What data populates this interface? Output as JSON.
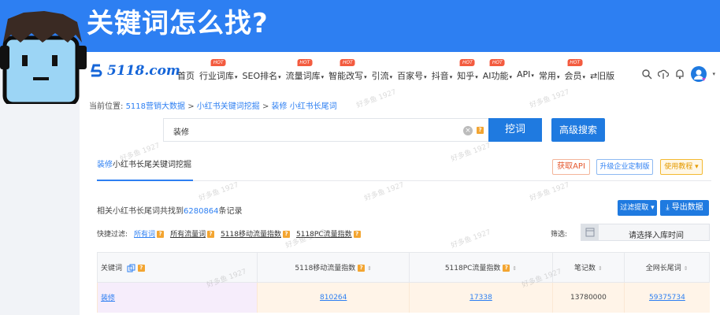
{
  "banner": {
    "title": "关键词怎么找?"
  },
  "logo": {
    "text": "5118.com"
  },
  "nav": {
    "items": [
      {
        "label": "首页",
        "caret": "",
        "hot": ""
      },
      {
        "label": "行业词库",
        "caret": "▾",
        "hot": "HOT"
      },
      {
        "label": "SEO排名",
        "caret": "▾",
        "hot": ""
      },
      {
        "label": "流量词库",
        "caret": "▾",
        "hot": "HOT"
      },
      {
        "label": "智能改写",
        "caret": "▾",
        "hot": "HOT"
      },
      {
        "label": "引流",
        "caret": "▾",
        "hot": ""
      },
      {
        "label": "百家号",
        "caret": "▾",
        "hot": ""
      },
      {
        "label": "抖音",
        "caret": "▾",
        "hot": ""
      },
      {
        "label": "知乎",
        "caret": "▾",
        "hot": "HOT"
      },
      {
        "label": "AI功能",
        "caret": "▾",
        "hot": "HOT"
      },
      {
        "label": "API",
        "caret": "▾",
        "hot": ""
      },
      {
        "label": "常用",
        "caret": "▾",
        "hot": ""
      },
      {
        "label": "会员",
        "caret": "▾",
        "hot": "HOT"
      },
      {
        "label": "⇄旧版",
        "caret": "",
        "hot": ""
      }
    ]
  },
  "breadcrumb": {
    "prefix": "当前位置:",
    "items": [
      "5118营销大数据",
      "小红书关键词挖掘",
      "装修 小红书长尾词"
    ],
    "sep": " > "
  },
  "search": {
    "value": "装修",
    "clear": "×",
    "help": "?",
    "submit_label": "挖词",
    "advanced_label": "高级搜索"
  },
  "section": {
    "keyword": "装修",
    "title_rest": "小红书长尾关键词挖掘",
    "api_label": "获取API",
    "upgrade_label": "升级企业定制版",
    "tutorial_label": "使用教程 ▾"
  },
  "summary": {
    "prefix": "相关小红书长尾词共找到",
    "count": "6280864",
    "suffix": "条记录",
    "filter_label": "过滤提取 ▾",
    "export_label": "⤓ 导出数据"
  },
  "quick_filter": {
    "label": "快捷过滤:",
    "items": [
      "所有词",
      "所有流量词",
      "5118移动流量指数",
      "5118PC流量指数"
    ],
    "sift_label": "筛选:",
    "date_placeholder": "请选择入库时间"
  },
  "table": {
    "headers": [
      "关键词",
      "5118移动流量指数",
      "5118PC流量指数",
      "笔记数",
      "全网长尾词"
    ],
    "rows": [
      [
        "装修",
        "810264",
        "17338",
        "13780000",
        "59375734"
      ]
    ]
  },
  "watermark": "好多鱼 1927"
}
